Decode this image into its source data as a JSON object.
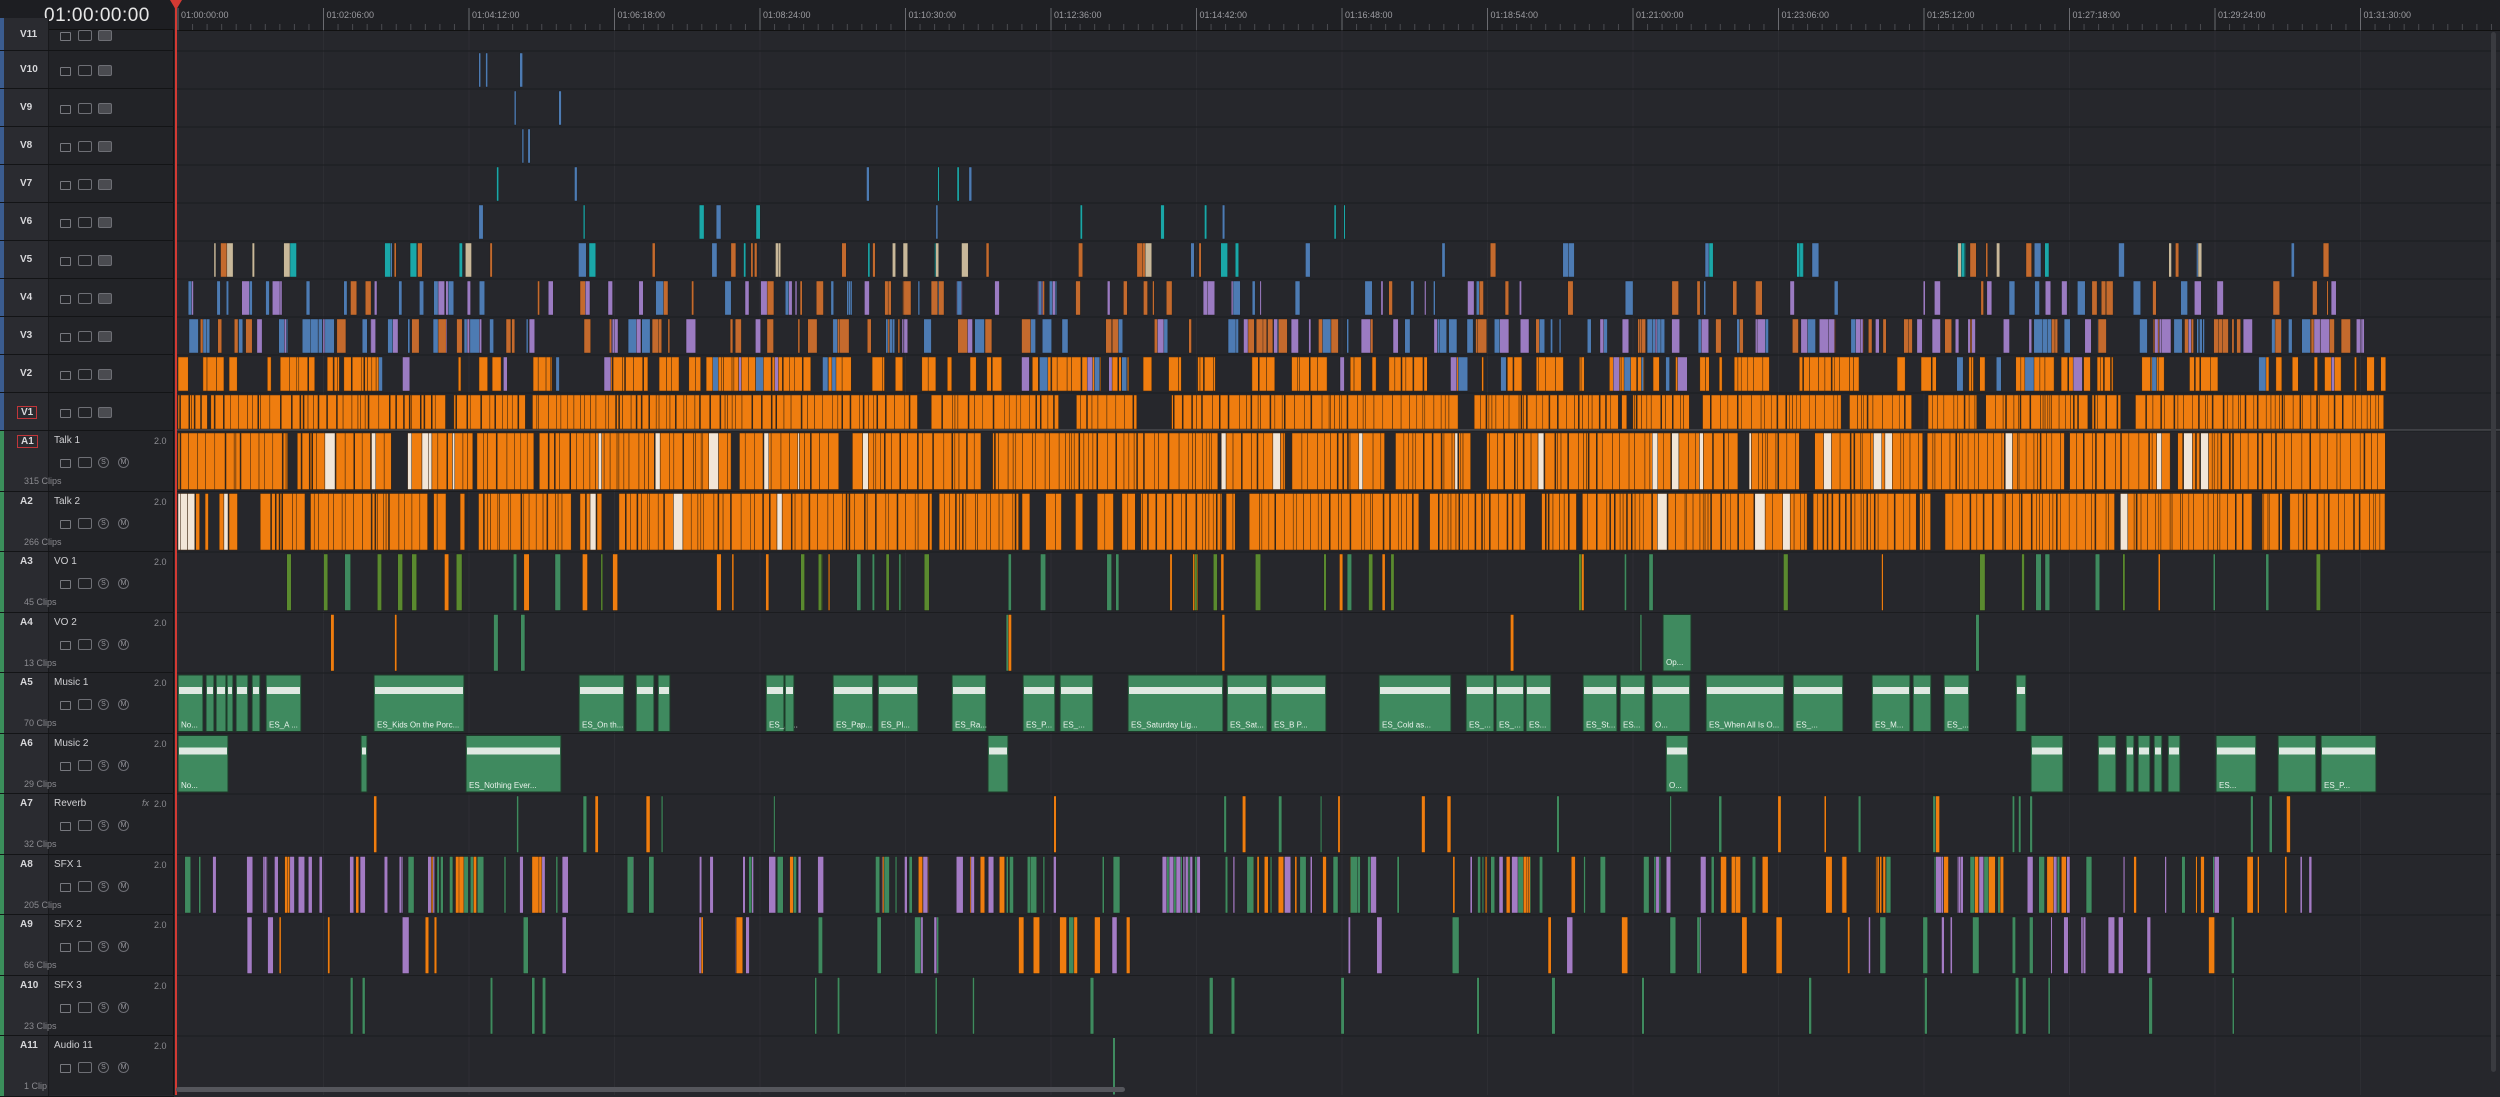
{
  "timeline": {
    "timecode": "01:00:00:00",
    "ruler_ticks": [
      "01:00:00:00",
      "01:02:06:00",
      "01:04:12:00",
      "01:06:18:00",
      "01:08:24:00",
      "01:10:30:00",
      "01:12:36:00",
      "01:14:42:00",
      "01:16:48:00",
      "01:18:54:00",
      "01:21:00:00",
      "01:23:06:00",
      "01:25:12:00",
      "01:27:18:00",
      "01:29:24:00",
      "01:31:30:00"
    ]
  },
  "video_tracks": [
    {
      "id": "V11"
    },
    {
      "id": "V10"
    },
    {
      "id": "V9"
    },
    {
      "id": "V8"
    },
    {
      "id": "V7"
    },
    {
      "id": "V6"
    },
    {
      "id": "V5"
    },
    {
      "id": "V4"
    },
    {
      "id": "V3"
    },
    {
      "id": "V2"
    },
    {
      "id": "V1"
    }
  ],
  "audio_tracks": [
    {
      "id": "A1",
      "name": "Talk 1",
      "channels": "2.0",
      "clips": "315 Clips"
    },
    {
      "id": "A2",
      "name": "Talk 2",
      "channels": "2.0",
      "clips": "266 Clips"
    },
    {
      "id": "A3",
      "name": "VO 1",
      "channels": "2.0",
      "clips": "45 Clips"
    },
    {
      "id": "A4",
      "name": "VO 2",
      "channels": "2.0",
      "clips": "13 Clips"
    },
    {
      "id": "A5",
      "name": "Music 1",
      "channels": "2.0",
      "clips": "70 Clips"
    },
    {
      "id": "A6",
      "name": "Music 2",
      "channels": "2.0",
      "clips": "29 Clips"
    },
    {
      "id": "A7",
      "name": "Reverb",
      "channels": "2.0",
      "fx": "fx",
      "clips": "32 Clips"
    },
    {
      "id": "A8",
      "name": "SFX 1",
      "channels": "2.0",
      "clips": "205 Clips"
    },
    {
      "id": "A9",
      "name": "SFX 2",
      "channels": "2.0",
      "clips": "66 Clips"
    },
    {
      "id": "A10",
      "name": "SFX 3",
      "channels": "2.0",
      "clips": "23 Clips"
    },
    {
      "id": "A11",
      "name": "Audio 11",
      "channels": "2.0",
      "clips": "1 Clip"
    }
  ],
  "track_controls": {
    "solo": "S",
    "mute": "M"
  },
  "clip_labels": {
    "music1": [
      "No...",
      "ES_A ...",
      "ES_Kids On the Porc...",
      "ES_On th...",
      "ES_A ...",
      "ES_Pap...",
      "ES_Pl...",
      "ES_Ra...",
      "ES_P...",
      "ES_...",
      "ES_Saturday Lig...",
      "ES_Sat...",
      "ES_B P...",
      "ES_Cold as...",
      "ES_...",
      "ES_...",
      "ES...",
      "ES_St...",
      "ES...",
      "O...",
      "ES_When All Is O...",
      "ES_...",
      "ES_M...",
      "ES_..."
    ],
    "music2": [
      "No...",
      "ES_Nothing Ever...",
      "O...",
      "ES...",
      "ES_P..."
    ],
    "vo2": [
      "Op..."
    ]
  },
  "colors": {
    "talk": "#ef7d0f",
    "video_blue": "#4d7bb3",
    "video_purple": "#9b7bc2",
    "video_teal": "#1aa7a8",
    "music": "#3f8a5f",
    "sfx_purple": "#a37bc4",
    "playhead": "#d33a33"
  }
}
